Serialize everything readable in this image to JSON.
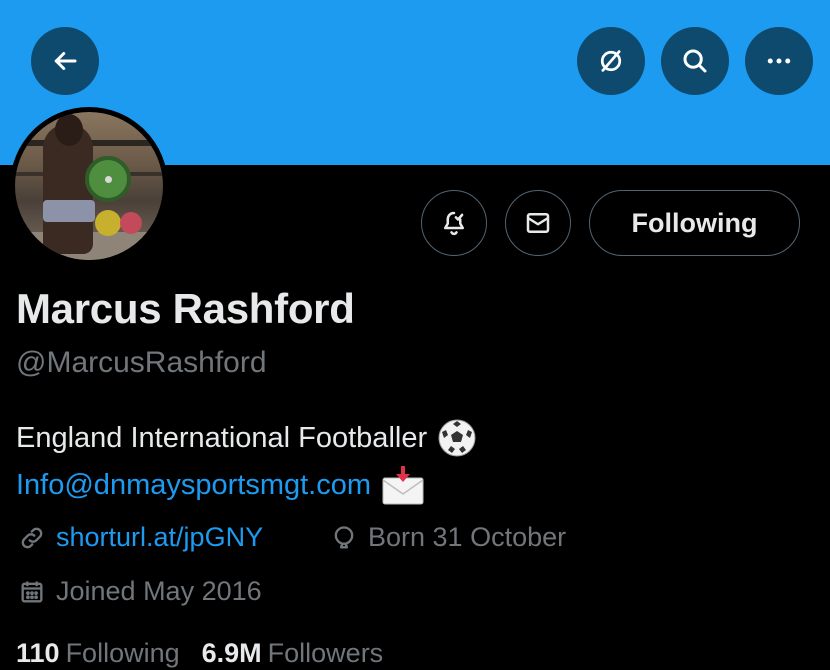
{
  "profile": {
    "name": "Marcus Rashford",
    "handle": "@MarcusRashford",
    "bio_line1": "England International Footballer",
    "bio_email": "Info@dnmaysportsmgt.com",
    "url": "shorturl.at/jpGNY",
    "born": "Born 31 October",
    "joined": "Joined May 2016"
  },
  "actions": {
    "following_label": "Following"
  },
  "stats": {
    "following_count": "110",
    "following_label": "Following",
    "followers_count": "6.9M",
    "followers_label": "Followers"
  },
  "icons": {
    "back": "arrow-left-icon",
    "no_show": "circle-slash-icon",
    "search": "search-icon",
    "more": "more-dots-icon",
    "notify": "bell-check-icon",
    "message": "envelope-icon",
    "link": "link-icon",
    "born": "balloon-icon",
    "joined": "calendar-icon",
    "bio_emoji": "soccer-ball-icon",
    "email_emoji": "incoming-envelope-icon"
  },
  "colors": {
    "banner": "#1d9bf0",
    "link": "#1d9bf0",
    "muted": "#71767b",
    "text": "#e7e9ea",
    "background": "#000000"
  }
}
